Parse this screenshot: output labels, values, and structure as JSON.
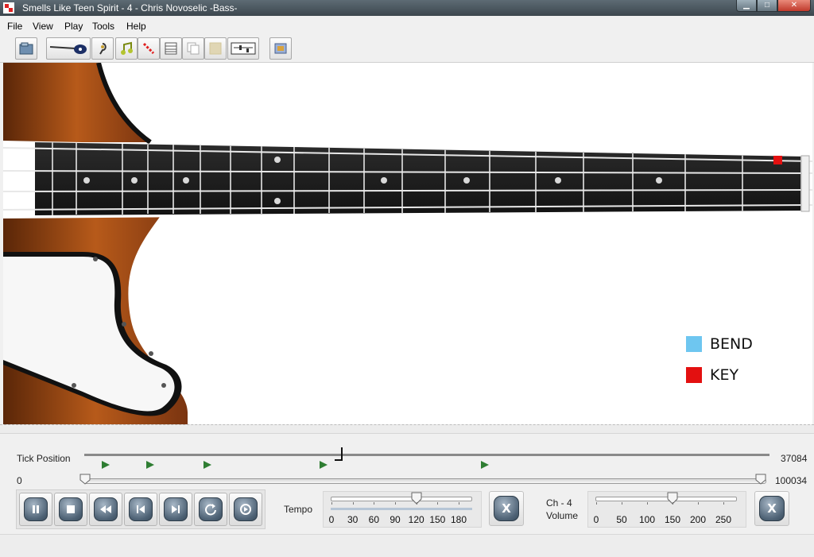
{
  "window": {
    "title": "Smells Like Teen Spirit - 4 - Chris Novoselic -Bass-",
    "controls": {
      "minimize": "▁",
      "maximize": "□",
      "close": "✕"
    }
  },
  "menu": {
    "file": "File",
    "view": "View",
    "play": "Play",
    "tools": "Tools",
    "help": "Help"
  },
  "toolbar": {
    "buttons": [
      "open-icon",
      "bass-guitar-icon",
      "tuning-icon",
      "note-icon",
      "piano-roll-icon",
      "grid-icon",
      "copy-icon",
      "blank-icon",
      "mixer-icon",
      "settings-icon"
    ]
  },
  "legend": {
    "bend": {
      "label": "BEND",
      "color": "#6ec6f0"
    },
    "key": {
      "label": "KEY",
      "color": "#e31010"
    }
  },
  "position": {
    "tick_label": "Tick Position",
    "tick_value": "37084",
    "start": "0",
    "end": "100034",
    "progress_fraction": 0.37
  },
  "tempo": {
    "label": "Tempo",
    "ticks": [
      "0",
      "30",
      "60",
      "90",
      "120",
      "150",
      "180"
    ],
    "value": 120,
    "max": 180,
    "reset_label": "X"
  },
  "volume": {
    "channel_label": "Ch - 4",
    "label": "Volume",
    "ticks": [
      "0",
      "50",
      "100",
      "150",
      "200",
      "250"
    ],
    "value": 150,
    "max": 250,
    "reset_label": "X"
  },
  "playback": {
    "buttons": [
      "pause-icon",
      "stop-icon",
      "rewind-icon",
      "previous-icon",
      "next-icon",
      "loop-icon",
      "record-icon"
    ]
  }
}
